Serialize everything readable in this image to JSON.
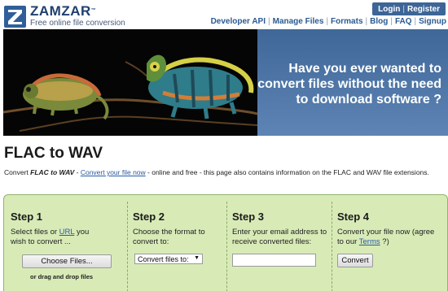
{
  "brand": {
    "name": "ZAMZAR",
    "trademark": "™",
    "tagline": "Free online file conversion"
  },
  "auth": {
    "login": "Login",
    "separator": "|",
    "register": "Register"
  },
  "nav": {
    "items": [
      "Developer API",
      "Manage Files",
      "Formats",
      "Blog",
      "FAQ",
      "Signup"
    ],
    "separator": "|"
  },
  "banner": {
    "line1": "Have you ever wanted to",
    "line2": "convert files without the need",
    "line3": "to download software ?"
  },
  "page": {
    "title": "FLAC to WAV",
    "intro_prefix": "Convert ",
    "intro_bold": "FLAC to WAV",
    "intro_dash": " - ",
    "intro_link": "Convert your file now",
    "intro_suffix": " - online and free - this page also contains information on the FLAC and WAV file extensions."
  },
  "steps": {
    "step1": {
      "heading": "Step 1",
      "text_before": "Select files or ",
      "link": "URL",
      "text_after": " you",
      "line2": "wish to convert ...",
      "button": "Choose Files...",
      "drag": "or drag and drop files"
    },
    "step2": {
      "heading": "Step 2",
      "line1": "Choose the format to",
      "line2": "convert to:",
      "select_value": "Convert files to:",
      "select_arrow": "▼"
    },
    "step3": {
      "heading": "Step 3",
      "line1": "Enter your email address to",
      "line2": "receive converted files:",
      "email_value": ""
    },
    "step4": {
      "heading": "Step 4",
      "line1": "Convert your file now (agree",
      "line2_before": "to our ",
      "line2_link": "Terms",
      "line2_after": " ?)",
      "button": "Convert"
    }
  },
  "colors": {
    "brand_blue": "#1f3f6e",
    "link_blue": "#2a5a92",
    "steps_bg": "#d8ebb7",
    "banner_blue": "#4a72a4"
  }
}
